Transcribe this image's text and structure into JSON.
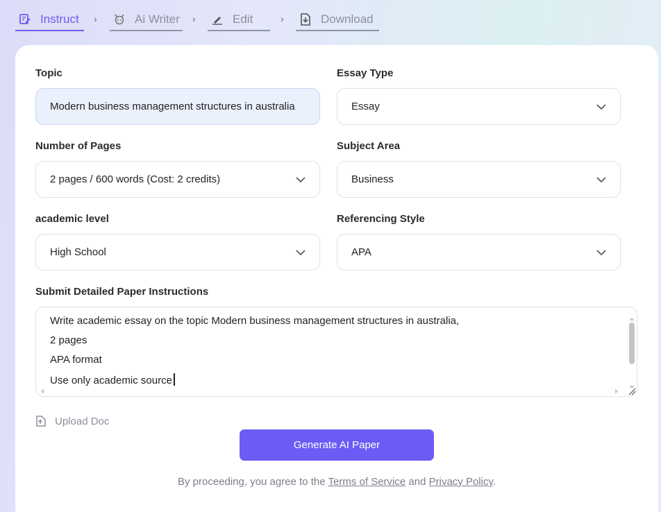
{
  "steps": [
    {
      "label": "Instruct",
      "icon": "edit-note-icon",
      "active": true
    },
    {
      "label": "Ai Writer",
      "icon": "robot-icon",
      "active": false
    },
    {
      "label": "Edit",
      "icon": "pencil-icon",
      "active": false
    },
    {
      "label": "Download",
      "icon": "download-file-icon",
      "active": false
    }
  ],
  "separator": "›",
  "form": {
    "topic_label": "Topic",
    "topic_value": "Modern business management structures in australia",
    "essay_type_label": "Essay Type",
    "essay_type_value": "Essay",
    "pages_label": "Number of Pages",
    "pages_value": "2 pages / 600 words (Cost: 2 credits)",
    "subject_label": "Subject Area",
    "subject_value": "Business",
    "academic_label": "academic level",
    "academic_value": "High School",
    "referencing_label": "Referencing Style",
    "referencing_value": "APA",
    "instructions_label": "Submit Detailed Paper Instructions",
    "instructions_lines": [
      "Write academic essay on the topic Modern business management structures in australia,",
      "2 pages",
      "APA format",
      "Use only academic source"
    ]
  },
  "upload_label": "Upload Doc",
  "generate_label": "Generate AI Paper",
  "terms": {
    "prefix": "By proceeding, you agree to the",
    "tos": "Terms of Service",
    "and": "and",
    "privacy": "Privacy Policy",
    "suffix": "."
  },
  "colors": {
    "accent": "#6c5cf5",
    "topic_bg": "#eaf0fc"
  }
}
